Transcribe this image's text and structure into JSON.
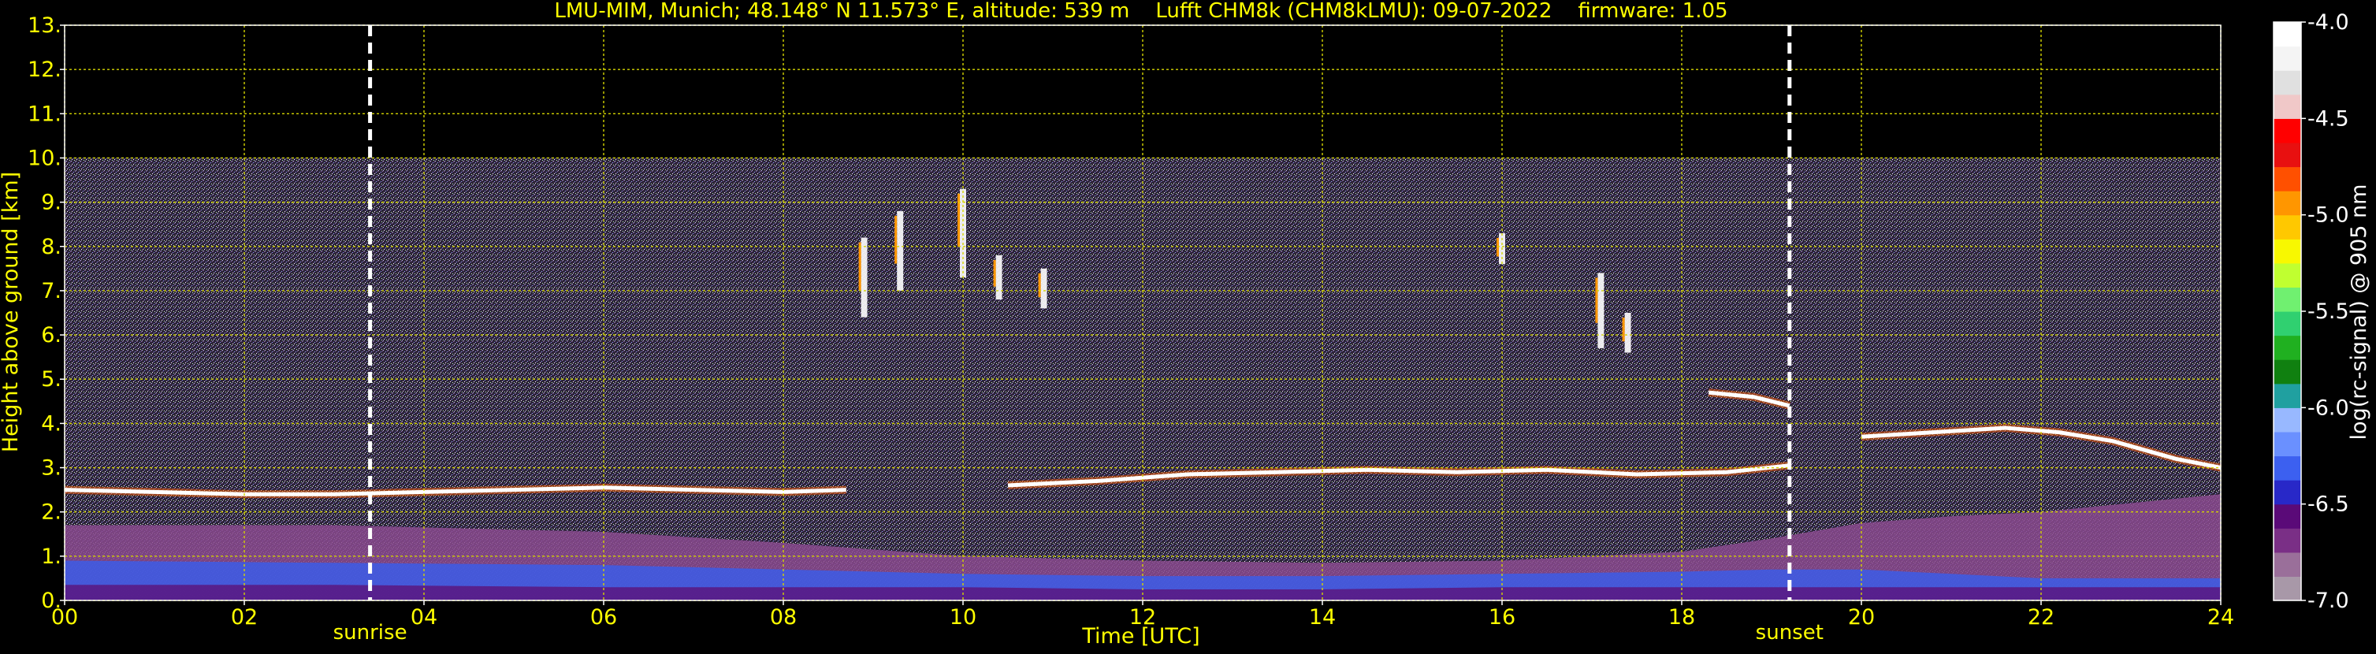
{
  "chart_data": {
    "type": "heatmap",
    "title": "LMU-MIM, Munich; 48.148° N 11.573° E, altitude: 539 m    Lufft CHM8k (CHM8kLMU): 09-07-2022    firmware: 1.05",
    "xlabel": "Time [UTC]",
    "ylabel": "Height above ground [km]",
    "colorbar_label": "log(rc-signal) @ 905 nm",
    "xlim": [
      0,
      24
    ],
    "ylim": [
      0,
      13
    ],
    "x_ticks": [
      "00",
      "02",
      "04",
      "06",
      "08",
      "10",
      "12",
      "14",
      "16",
      "18",
      "20",
      "22",
      "24"
    ],
    "x_tick_values": [
      0,
      2,
      4,
      6,
      8,
      10,
      12,
      14,
      16,
      18,
      20,
      22,
      24
    ],
    "y_ticks": [
      "0.",
      "1.",
      "2.",
      "3.",
      "4.",
      "5.",
      "6.",
      "7.",
      "8.",
      "9.",
      "10.",
      "11.",
      "12.",
      "13."
    ],
    "y_tick_values": [
      0,
      1,
      2,
      3,
      4,
      5,
      6,
      7,
      8,
      9,
      10,
      11,
      12,
      13
    ],
    "grid": true,
    "measurement_ceiling_km": 10,
    "events": [
      {
        "label": "sunrise",
        "time": 3.4
      },
      {
        "label": "sunset",
        "time": 19.2
      }
    ],
    "colorbar": {
      "range": [
        -7.0,
        -4.0
      ],
      "tick_labels": [
        "-7.0",
        "-6.5",
        "-6.0",
        "-5.5",
        "-5.0",
        "-4.5",
        "-4.0"
      ],
      "tick_values": [
        -7.0,
        -6.5,
        -6.0,
        -5.5,
        -5.0,
        -4.5,
        -4.0
      ],
      "colors": [
        "#a898a8",
        "#9a6f9a",
        "#7a2f86",
        "#5a0a78",
        "#2828c8",
        "#3c60f0",
        "#6a90ff",
        "#98b8ff",
        "#20a0a0",
        "#108010",
        "#20b020",
        "#30d070",
        "#70f070",
        "#c0ff30",
        "#f8f800",
        "#ffc800",
        "#ff9600",
        "#ff5000",
        "#e81010",
        "#ff0000",
        "#f0c8c8",
        "#e0e0e0",
        "#f4f4f4",
        "#ffffff"
      ]
    },
    "colors": {
      "text": "#ffff00",
      "grid": "#d4d400",
      "background": "#000000",
      "event_line": "#ffffff"
    },
    "cloud_layers": [
      {
        "t": [
          0.0,
          1.0,
          2.0,
          3.0,
          4.0,
          5.0,
          6.0,
          7.0,
          8.0,
          8.7
        ],
        "h": [
          2.5,
          2.45,
          2.4,
          2.4,
          2.45,
          2.5,
          2.55,
          2.5,
          2.45,
          2.5
        ]
      },
      {
        "t": [
          10.5,
          11.5,
          12.5,
          13.5,
          14.5,
          15.5,
          16.5,
          17.5,
          18.5,
          19.2
        ],
        "h": [
          2.6,
          2.7,
          2.85,
          2.9,
          2.95,
          2.9,
          2.95,
          2.85,
          2.9,
          3.05
        ]
      },
      {
        "t": [
          20.0,
          20.8,
          21.6,
          22.2,
          22.8,
          23.5,
          24.0
        ],
        "h": [
          3.7,
          3.8,
          3.9,
          3.8,
          3.6,
          3.2,
          3.0
        ]
      },
      {
        "t": [
          18.3,
          18.8,
          19.2
        ],
        "h": [
          4.7,
          4.6,
          4.4
        ]
      }
    ],
    "cirrus_patches": [
      {
        "t": 8.9,
        "h0": 6.4,
        "h1": 8.2
      },
      {
        "t": 9.3,
        "h0": 7.0,
        "h1": 8.8
      },
      {
        "t": 10.0,
        "h0": 7.3,
        "h1": 9.3
      },
      {
        "t": 10.4,
        "h0": 6.8,
        "h1": 7.8
      },
      {
        "t": 10.9,
        "h0": 6.6,
        "h1": 7.5
      },
      {
        "t": 16.0,
        "h0": 7.6,
        "h1": 8.3
      },
      {
        "t": 17.1,
        "h0": 5.7,
        "h1": 7.4
      },
      {
        "t": 17.4,
        "h0": 5.6,
        "h1": 6.5
      }
    ],
    "boundary_layer_bands": [
      {
        "t": [
          0,
          3,
          6,
          8,
          10,
          12,
          14,
          16,
          18,
          19,
          20,
          21,
          22,
          23,
          24
        ],
        "h": [
          1.7,
          1.7,
          1.55,
          1.3,
          1.0,
          0.9,
          0.85,
          0.9,
          1.1,
          1.4,
          1.75,
          1.9,
          2.0,
          2.2,
          2.4
        ],
        "color": "#8a4a8e"
      },
      {
        "t": [
          0,
          3,
          6,
          8,
          10,
          12,
          14,
          16,
          18,
          19,
          20,
          21,
          22,
          23,
          24
        ],
        "h": [
          0.9,
          0.85,
          0.8,
          0.7,
          0.6,
          0.55,
          0.55,
          0.6,
          0.65,
          0.7,
          0.7,
          0.6,
          0.5,
          0.5,
          0.5
        ],
        "color": "#3c5ce8"
      },
      {
        "t": [
          0,
          3,
          6,
          8,
          10,
          12,
          14,
          16,
          18,
          19,
          20,
          21,
          22,
          23,
          24
        ],
        "h": [
          0.35,
          0.35,
          0.3,
          0.3,
          0.3,
          0.25,
          0.25,
          0.3,
          0.3,
          0.3,
          0.3,
          0.3,
          0.3,
          0.3,
          0.3
        ],
        "color": "#5a1680"
      }
    ]
  }
}
